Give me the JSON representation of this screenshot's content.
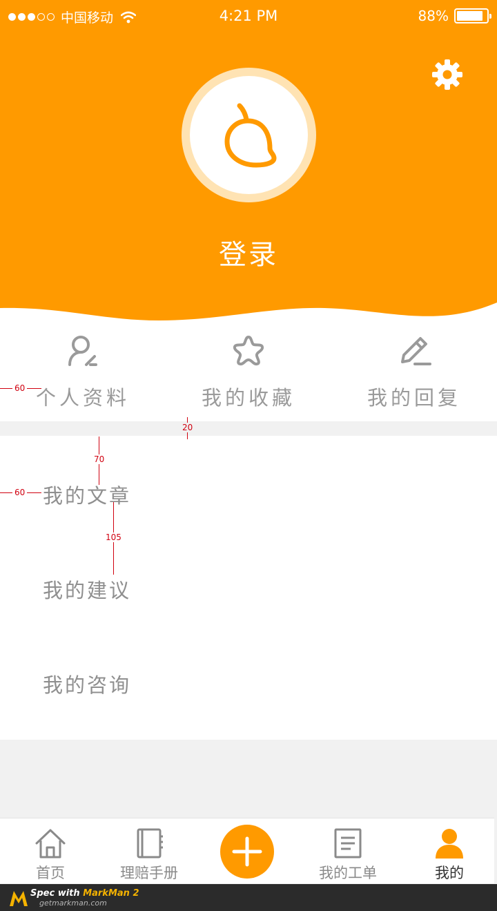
{
  "status_bar": {
    "carrier": "中国移动",
    "time": "4:21 PM",
    "battery": "88%",
    "battery_level": 0.88,
    "signal_bars": 3,
    "signal_total": 5
  },
  "header": {
    "login_label": "登录",
    "background_color": "#ff9a00",
    "avatar_icon": "mango-icon",
    "settings_icon": "gear-icon"
  },
  "quick_actions": [
    {
      "label": "个人资料",
      "icon": "user-edit-icon"
    },
    {
      "label": "我的收藏",
      "icon": "star-icon"
    },
    {
      "label": "我的回复",
      "icon": "pencil-icon"
    }
  ],
  "menu_items": [
    {
      "label": "我的文章"
    },
    {
      "label": "我的建议"
    },
    {
      "label": "我的咨询"
    }
  ],
  "tab_bar": {
    "tabs": [
      {
        "label": "首页",
        "icon": "home-icon",
        "active": false
      },
      {
        "label": "理赔手册",
        "icon": "notebook-icon",
        "active": false
      },
      {
        "label": "",
        "icon": "plus-icon",
        "active": false
      },
      {
        "label": "我的工单",
        "icon": "document-icon",
        "active": false
      },
      {
        "label": "我的",
        "icon": "person-icon",
        "active": true
      }
    ],
    "active_color": "#ff9a00"
  },
  "annotations": {
    "left_margin_1": "60",
    "gap": "20",
    "top_padding": "70",
    "left_margin_2": "60",
    "row_spacing": "105"
  },
  "watermark": {
    "title_prefix": "Spec with ",
    "title_brand": "MarkMan 2",
    "subtitle": "getmarkman.com"
  }
}
